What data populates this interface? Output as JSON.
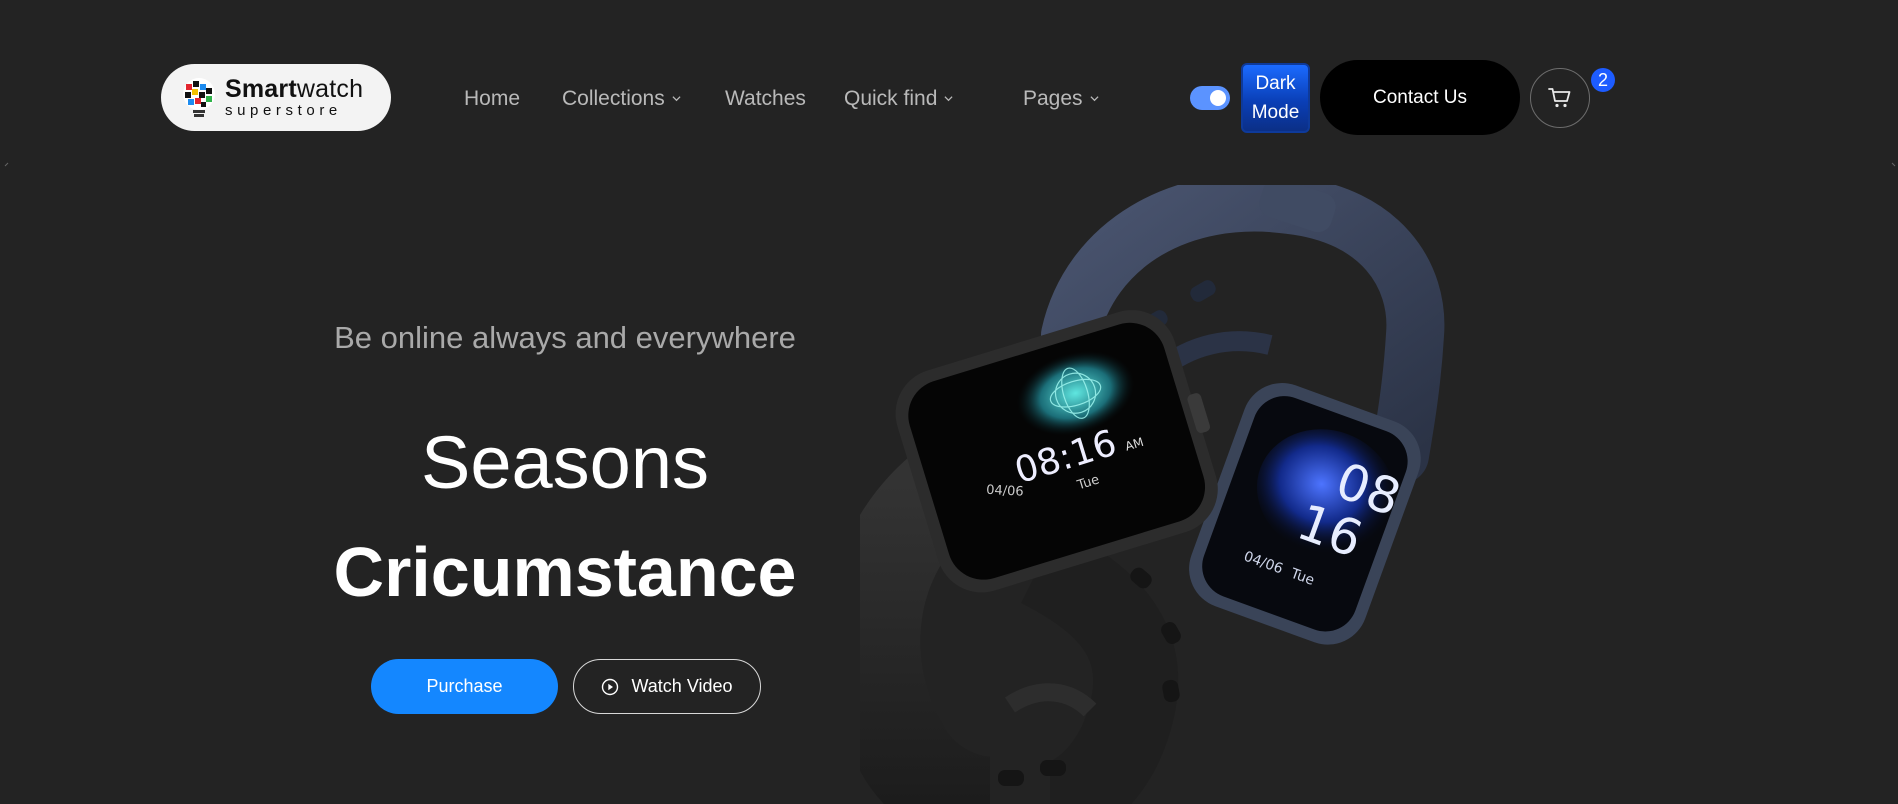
{
  "header": {
    "logo": {
      "line1_bold": "Smart",
      "line1_light": "watch",
      "line2": "superstore"
    },
    "nav": [
      {
        "label": "Home",
        "has_dropdown": false
      },
      {
        "label": "Collections",
        "has_dropdown": true
      },
      {
        "label": "Watches",
        "has_dropdown": false
      },
      {
        "label": "Quick find",
        "has_dropdown": true
      },
      {
        "label": "Pages",
        "has_dropdown": true
      }
    ],
    "theme_toggle": {
      "on": true
    },
    "dark_mode": {
      "line1": "Dark",
      "line2": "Mode"
    },
    "contact_label": "Contact Us",
    "cart_count": "2"
  },
  "hero": {
    "tagline": "Be online always and everywhere",
    "title_line1": "Seasons",
    "title_line2": "Cricumstance",
    "purchase_label": "Purchase",
    "watch_video_label": "Watch Video"
  },
  "watch_faces": {
    "front": {
      "time": "08:16",
      "ampm": "AM",
      "date": "04/06",
      "day": "Tue"
    },
    "back": {
      "hour": "08",
      "minute": "16",
      "date": "04/06",
      "day": "Tue"
    }
  },
  "colors": {
    "background": "#232323",
    "accent_blue": "#1487ff",
    "badge_blue": "#1d5cff",
    "strap_navy": "#3a4458",
    "strap_black": "#262626"
  }
}
